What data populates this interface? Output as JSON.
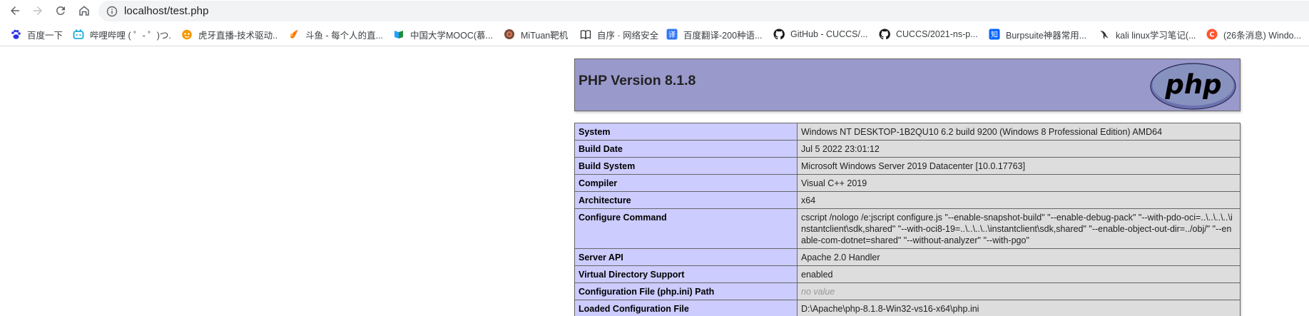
{
  "browser": {
    "url": "localhost/test.php",
    "bookmarks": [
      {
        "label": "百度一下",
        "icon": "baidu-paw-icon",
        "color": "#2932e1"
      },
      {
        "label": "哔哩哔哩 ( ゜- ゜)つ...",
        "icon": "bilibili-tv-icon",
        "color": "#00a1d6"
      },
      {
        "label": "虎牙直播-技术驱动...",
        "icon": "huya-icon",
        "color": "#f39800"
      },
      {
        "label": "斗鱼 - 每个人的直...",
        "icon": "douyu-icon",
        "color": "#ff7700"
      },
      {
        "label": "中国大学MOOC(慕...",
        "icon": "mooc-flag-icon",
        "color": "#22a1ff"
      },
      {
        "label": "MiTuan靶机",
        "icon": "mituan-icon",
        "color": "#a0522d"
      },
      {
        "label": "自序 · 网络安全",
        "icon": "book-icon",
        "color": "#333333"
      },
      {
        "label": "百度翻译-200种语...",
        "icon": "translate-icon",
        "color": "#3478f6"
      },
      {
        "label": "GitHub - CUCCS/...",
        "icon": "github-icon",
        "color": "#181717"
      },
      {
        "label": "CUCCS/2021-ns-p...",
        "icon": "github-icon",
        "color": "#181717"
      },
      {
        "label": "Burpsuite神器常用...",
        "icon": "zhihu-icon",
        "color": "#0066ff"
      },
      {
        "label": "kali linux学习笔记(...",
        "icon": "kali-dragon-icon",
        "color": "#333333"
      },
      {
        "label": "(26条消息) Windo...",
        "icon": "csdn-icon",
        "color": "#fc5531"
      }
    ]
  },
  "phpinfo": {
    "version_title": "PHP Version 8.1.8",
    "logo_text": "php",
    "rows": [
      {
        "key": "System",
        "value": "Windows NT DESKTOP-1B2QU10 6.2 build 9200 (Windows 8 Professional Edition) AMD64"
      },
      {
        "key": "Build Date",
        "value": "Jul 5 2022 23:01:12"
      },
      {
        "key": "Build System",
        "value": "Microsoft Windows Server 2019 Datacenter [10.0.17763]"
      },
      {
        "key": "Compiler",
        "value": "Visual C++ 2019"
      },
      {
        "key": "Architecture",
        "value": "x64"
      },
      {
        "key": "Configure Command",
        "value": "cscript /nologo /e:jscript configure.js \"--enable-snapshot-build\" \"--enable-debug-pack\" \"--with-pdo-oci=..\\..\\..\\..\\instantclient\\sdk,shared\" \"--with-oci8-19=..\\..\\..\\..\\instantclient\\sdk,shared\" \"--enable-object-out-dir=../obj/\" \"--enable-com-dotnet=shared\" \"--without-analyzer\" \"--with-pgo\""
      },
      {
        "key": "Server API",
        "value": "Apache 2.0 Handler"
      },
      {
        "key": "Virtual Directory Support",
        "value": "enabled"
      },
      {
        "key": "Configuration File (php.ini) Path",
        "value": "no value",
        "no_value": true
      },
      {
        "key": "Loaded Configuration File",
        "value": "D:\\Apache\\php-8.1.8-Win32-vs16-x64\\php.ini"
      }
    ]
  }
}
